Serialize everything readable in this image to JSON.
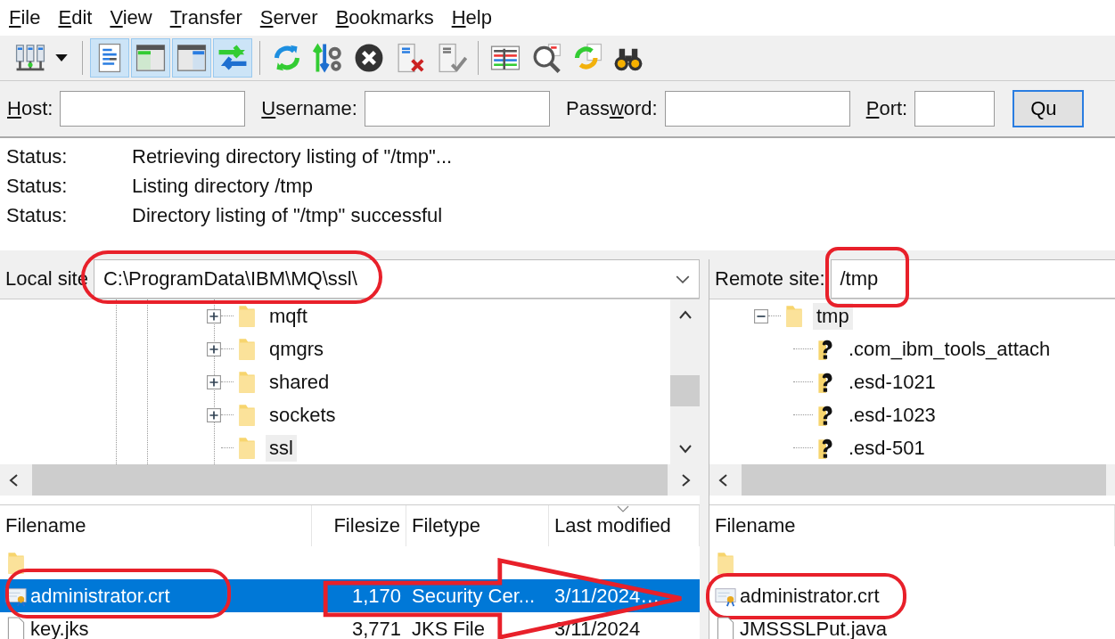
{
  "menu": [
    {
      "key": "F",
      "rest": "ile"
    },
    {
      "key": "E",
      "rest": "dit"
    },
    {
      "key": "V",
      "rest": "iew"
    },
    {
      "key": "T",
      "rest": "ransfer"
    },
    {
      "key": "S",
      "rest": "erver"
    },
    {
      "key": "B",
      "rest": "ookmarks"
    },
    {
      "key": "H",
      "rest": "elp"
    }
  ],
  "toolbar": {
    "groups": [
      [
        {
          "selected": false
        }
      ],
      [
        {
          "selected": true
        },
        {
          "selected": true
        },
        {
          "selected": true
        },
        {
          "selected": true
        }
      ],
      [
        {
          "selected": false
        },
        {
          "selected": false
        },
        {
          "selected": false
        },
        {
          "selected": false
        },
        {
          "selected": false
        }
      ],
      [
        {
          "selected": false
        },
        {
          "selected": false
        },
        {
          "selected": false
        },
        {
          "selected": false
        }
      ]
    ]
  },
  "quickconnect": {
    "fields": [
      {
        "key": "H",
        "rest": "ost:"
      },
      {
        "key": "U",
        "rest": "sername:"
      },
      {
        "before": "Pass",
        "key": "w",
        "rest": "ord:"
      },
      {
        "key": "P",
        "rest": "ort:"
      }
    ],
    "button": "Qu"
  },
  "message_log": [
    {
      "label": "Status:",
      "text": "Retrieving directory listing of \"/tmp\"..."
    },
    {
      "label": "Status:",
      "text": "Listing directory /tmp"
    },
    {
      "label": "Status:",
      "text": "Directory listing of \"/tmp\" successful"
    }
  ],
  "local": {
    "site_label": "Local site",
    "path": "C:\\ProgramData\\IBM\\MQ\\ssl\\",
    "tree": [
      {
        "name": "mqft",
        "expandable": true,
        "selected": false
      },
      {
        "name": "qmgrs",
        "expandable": true,
        "selected": false
      },
      {
        "name": "shared",
        "expandable": true,
        "selected": false
      },
      {
        "name": "sockets",
        "expandable": true,
        "selected": false
      },
      {
        "name": "ssl",
        "expandable": false,
        "selected": true
      }
    ],
    "columns": [
      {
        "label": "Filename",
        "sorted": false
      },
      {
        "label": "Filesize",
        "sorted": false
      },
      {
        "label": "Filetype",
        "sorted": false
      },
      {
        "label": "Last modified",
        "sorted": true
      }
    ],
    "files": [
      {
        "kind": "folder",
        "selected": false
      },
      {
        "kind": "certificate",
        "name": "administrator.crt",
        "size": "1,170",
        "type": "Security Cer...",
        "modified": "3/11/2024…",
        "selected": true
      },
      {
        "kind": "file",
        "name": "key.jks",
        "size": "3,771",
        "type": "JKS File",
        "modified": "3/11/2024",
        "selected": false
      }
    ]
  },
  "remote": {
    "site_label": "Remote site:",
    "path": "/tmp",
    "tree": [
      {
        "name": "tmp",
        "expanded": true,
        "selected": true,
        "children": [
          {
            "name": ".com_ibm_tools_attach",
            "kind": "unknown"
          },
          {
            "name": ".esd-1021",
            "kind": "unknown"
          },
          {
            "name": ".esd-1023",
            "kind": "unknown"
          },
          {
            "name": ".esd-501",
            "kind": "unknown"
          }
        ]
      }
    ],
    "columns": [
      {
        "label": "Filename"
      }
    ],
    "files": [
      {
        "kind": "folder",
        "selected": false
      },
      {
        "kind": "certificate",
        "name": "administrator.crt",
        "selected": false
      },
      {
        "kind": "file",
        "name": "JMSSSLPut.java",
        "selected": false
      }
    ]
  }
}
